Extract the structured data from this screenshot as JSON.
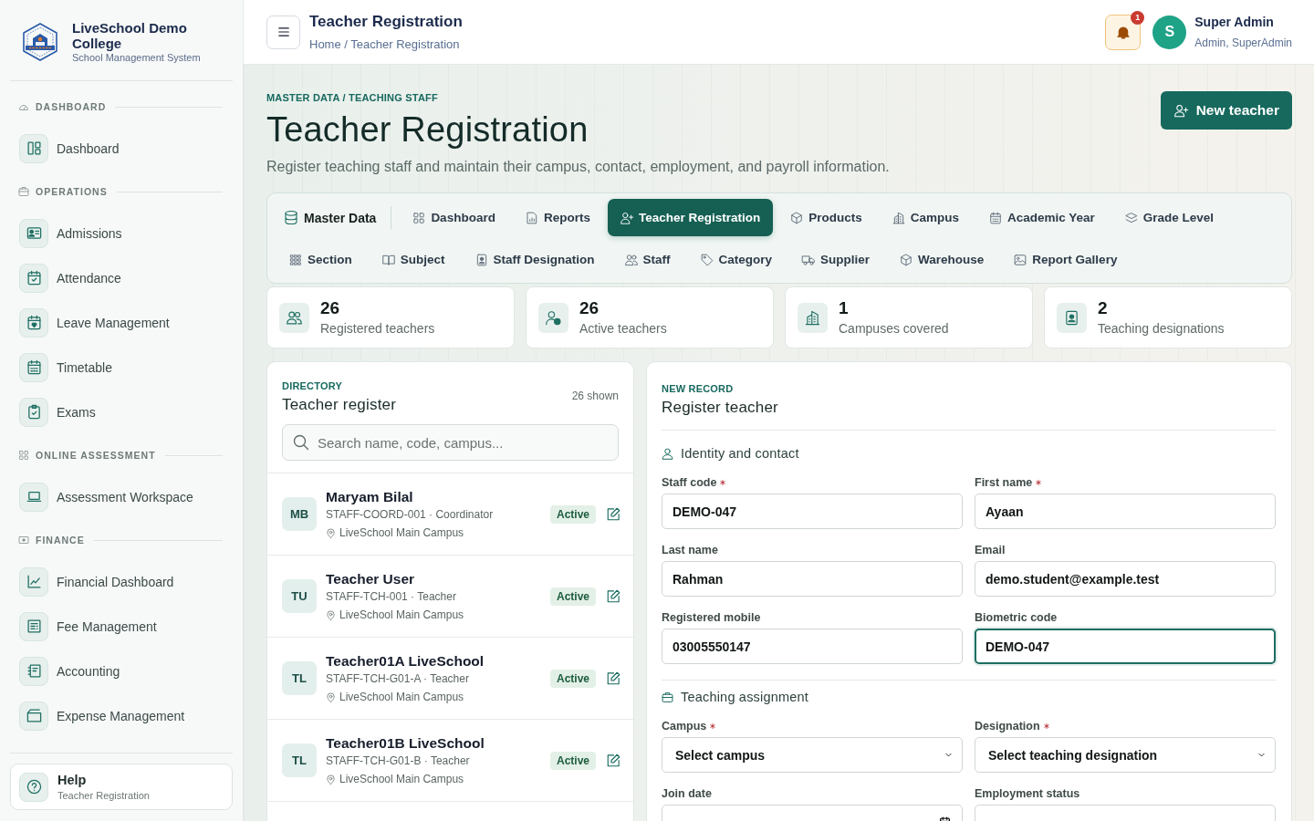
{
  "sidebar": {
    "brand": {
      "title": "LiveSchool Demo College",
      "subtitle": "School Management System"
    },
    "sections": [
      {
        "heading": "DASHBOARD",
        "items": [
          {
            "label": "Dashboard",
            "selected": false
          }
        ]
      },
      {
        "heading": "OPERATIONS",
        "items": [
          {
            "label": "Admissions",
            "selected": false
          },
          {
            "label": "Attendance",
            "selected": false
          },
          {
            "label": "Leave Management",
            "selected": false
          },
          {
            "label": "Timetable",
            "selected": false
          },
          {
            "label": "Exams",
            "selected": false
          }
        ]
      },
      {
        "heading": "ONLINE ASSESSMENT",
        "items": [
          {
            "label": "Assessment Workspace",
            "selected": false
          }
        ]
      },
      {
        "heading": "FINANCE",
        "items": [
          {
            "label": "Financial Dashboard",
            "selected": false
          },
          {
            "label": "Fee Management",
            "selected": false
          },
          {
            "label": "Accounting",
            "selected": false
          },
          {
            "label": "Expense Management",
            "selected": false
          }
        ]
      }
    ],
    "help": {
      "title": "Help",
      "subtitle": "Teacher Registration"
    }
  },
  "header": {
    "title": "Teacher Registration",
    "breadcrumb": "Home / Teacher Registration",
    "notifications": {
      "count": "1"
    },
    "user": {
      "initials": "S",
      "name": "Super Admin",
      "roles": "Admin, SuperAdmin"
    }
  },
  "page": {
    "eyebrow": "MASTER DATA / TEACHING STAFF",
    "title": "Teacher Registration",
    "subtitle": "Register teaching staff and maintain their campus, contact, employment, and payroll information.",
    "action": "New teacher"
  },
  "tab_rows": [
    [
      {
        "label": "Master Data",
        "kind": "module",
        "selected": false
      },
      {
        "label": "Dashboard",
        "kind": "tab",
        "selected": false
      },
      {
        "label": "Reports",
        "kind": "tab",
        "selected": false
      },
      {
        "label": "Teacher Registration",
        "kind": "tab",
        "selected": true
      },
      {
        "label": "Products",
        "kind": "tab",
        "selected": false
      },
      {
        "label": "Campus",
        "kind": "tab",
        "selected": false
      },
      {
        "label": "Academic Year",
        "kind": "tab",
        "selected": false
      },
      {
        "label": "Grade Level",
        "kind": "tab",
        "selected": false
      }
    ],
    [
      {
        "label": "Section",
        "kind": "tab",
        "selected": false
      },
      {
        "label": "Subject",
        "kind": "tab",
        "selected": false
      },
      {
        "label": "Staff Designation",
        "kind": "tab",
        "selected": false
      },
      {
        "label": "Staff",
        "kind": "tab",
        "selected": false
      },
      {
        "label": "Category",
        "kind": "tab",
        "selected": false
      },
      {
        "label": "Supplier",
        "kind": "tab",
        "selected": false
      },
      {
        "label": "Warehouse",
        "kind": "tab",
        "selected": false
      },
      {
        "label": "Report Gallery",
        "kind": "tab",
        "selected": false
      }
    ]
  ],
  "stats": [
    {
      "value": "26",
      "label": "Registered teachers"
    },
    {
      "value": "26",
      "label": "Active teachers"
    },
    {
      "value": "1",
      "label": "Campuses covered"
    },
    {
      "value": "2",
      "label": "Teaching designations"
    }
  ],
  "directory": {
    "eyebrow": "DIRECTORY",
    "title": "Teacher register",
    "count": "26 shown",
    "search": {
      "placeholder": "Search name, code, campus..."
    },
    "teachers": [
      {
        "initials": "MB",
        "name": "Maryam Bilal",
        "meta": "STAFF-COORD-001 · Coordinator",
        "campus": "LiveSchool Main Campus",
        "status": "Active"
      },
      {
        "initials": "TU",
        "name": "Teacher User",
        "meta": "STAFF-TCH-001 · Teacher",
        "campus": "LiveSchool Main Campus",
        "status": "Active"
      },
      {
        "initials": "TL",
        "name": "Teacher01A LiveSchool",
        "meta": "STAFF-TCH-G01-A · Teacher",
        "campus": "LiveSchool Main Campus",
        "status": "Active"
      },
      {
        "initials": "TL",
        "name": "Teacher01B LiveSchool",
        "meta": "STAFF-TCH-G01-B · Teacher",
        "campus": "LiveSchool Main Campus",
        "status": "Active"
      }
    ]
  },
  "form": {
    "eyebrow": "NEW RECORD",
    "title": "Register teacher",
    "sections": [
      {
        "title": "Identity and contact",
        "fields": [
          {
            "label": "Staff code",
            "required": true,
            "kind": "text",
            "value": "DEMO-047",
            "focused": false
          },
          {
            "label": "First name",
            "required": true,
            "kind": "text",
            "value": "Ayaan",
            "focused": false
          },
          {
            "label": "Last name",
            "required": false,
            "kind": "text",
            "value": "Rahman",
            "focused": false
          },
          {
            "label": "Email",
            "required": false,
            "kind": "text",
            "value": "demo.student@example.test",
            "focused": false
          },
          {
            "label": "Registered mobile",
            "required": false,
            "kind": "text",
            "value": "03005550147",
            "focused": false
          },
          {
            "label": "Biometric code",
            "required": false,
            "kind": "text",
            "value": "DEMO-047",
            "focused": true
          }
        ]
      },
      {
        "title": "Teaching assignment",
        "fields": [
          {
            "label": "Campus",
            "required": true,
            "kind": "select",
            "value": "Select campus",
            "focused": false
          },
          {
            "label": "Designation",
            "required": true,
            "kind": "select",
            "value": "Select teaching designation",
            "focused": false
          },
          {
            "label": "Join date",
            "required": false,
            "kind": "date",
            "focused": false
          },
          {
            "label": "Employment status",
            "required": false,
            "kind": "text",
            "focused": false
          }
        ]
      }
    ]
  }
}
